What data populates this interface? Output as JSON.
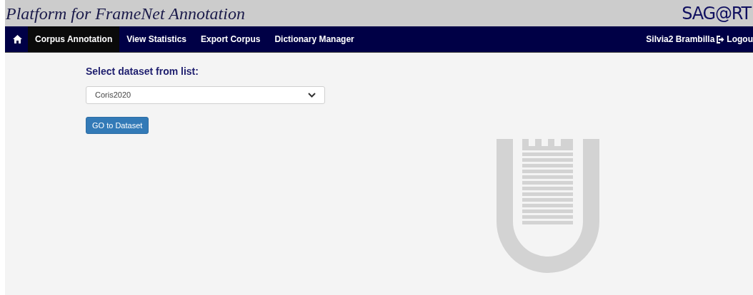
{
  "header": {
    "title": "Platform for FrameNet Annotation",
    "logo_text": "SAG@RT"
  },
  "nav": {
    "items": [
      {
        "label": "Corpus Annotation",
        "selected": true
      },
      {
        "label": "View Statistics",
        "selected": false
      },
      {
        "label": "Export Corpus",
        "selected": false
      },
      {
        "label": "Dictionary Manager",
        "selected": false
      }
    ],
    "user": "Silvia2 Brambilla",
    "logout": "Logou"
  },
  "form": {
    "label": "Select dataset from list:",
    "dataset": "Coris2020",
    "button": "GO to Dataset"
  }
}
